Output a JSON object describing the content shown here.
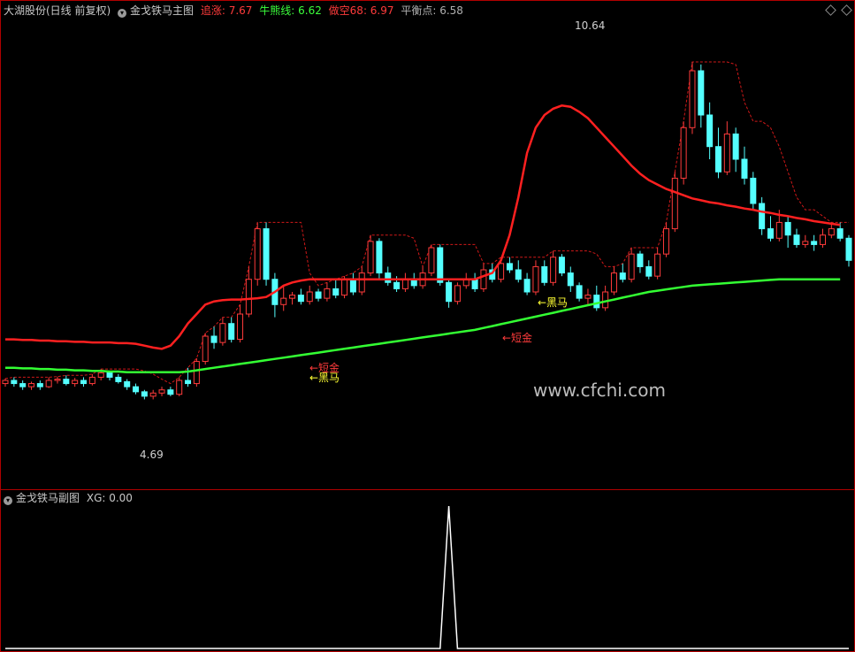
{
  "main_header": {
    "stock": "大湖股份(日线 前复权)",
    "indicator": "金戈铁马主图",
    "items": [
      {
        "label": "追涨: 7.67",
        "color": "#ff3b3b"
      },
      {
        "label": "牛熊线: 6.62",
        "color": "#3cff3c"
      },
      {
        "label": "做空68: 6.97",
        "color": "#ff3b3b"
      },
      {
        "label": "平衡点: 6.58",
        "color": "#b0b0b0"
      }
    ]
  },
  "sub_header": {
    "indicator": "金戈铁马副图",
    "xg": "XG: 0.00"
  },
  "icons": [
    "chevron-down-icon",
    "diamond-icon"
  ],
  "colors": {
    "up": "#ff3b3b",
    "down": "#54ffff",
    "bull_bear": "#33ff33",
    "chase": "#ff2020",
    "sub_line": "#ffffff",
    "frame": "#b00000"
  },
  "annotations": {
    "high_price": "10.64",
    "low_price": "4.69",
    "dark_horse_1": "←黑马",
    "short_gold_1": "←短金",
    "dark_horse_2": "←黑马",
    "short_gold_2": "←短金"
  },
  "watermark": "www.cfchi.com",
  "chart_data": [
    {
      "type": "candlestick",
      "title": "金戈铁马主图",
      "ylim": [
        4.2,
        11.2
      ],
      "series": [
        {
          "name": "追涨",
          "values": [
            6.25,
            6.25,
            6.24,
            6.24,
            6.23,
            6.23,
            6.22,
            6.22,
            6.21,
            6.21,
            6.2,
            6.2,
            6.2,
            6.19,
            6.19,
            6.18,
            6.15,
            6.12,
            6.1,
            6.15,
            6.3,
            6.5,
            6.65,
            6.8,
            6.85,
            6.87,
            6.88,
            6.88,
            6.89,
            6.9,
            6.92,
            7.0,
            7.1,
            7.15,
            7.18,
            7.2,
            7.2,
            7.2,
            7.2,
            7.2,
            7.2,
            7.2,
            7.2,
            7.2,
            7.2,
            7.2,
            7.2,
            7.2,
            7.2,
            7.2,
            7.2,
            7.2,
            7.2,
            7.2,
            7.2,
            7.25,
            7.3,
            7.5,
            7.9,
            8.5,
            9.2,
            9.6,
            9.8,
            9.9,
            9.95,
            9.93,
            9.85,
            9.75,
            9.6,
            9.45,
            9.3,
            9.15,
            9.0,
            8.87,
            8.77,
            8.7,
            8.63,
            8.58,
            8.53,
            8.48,
            8.45,
            8.42,
            8.4,
            8.37,
            8.35,
            8.32,
            8.3,
            8.27,
            8.25,
            8.22,
            8.2,
            8.17,
            8.15,
            8.12,
            8.1,
            8.08,
            8.06
          ]
        },
        {
          "name": "牛熊线",
          "values": [
            5.8,
            5.8,
            5.79,
            5.79,
            5.78,
            5.78,
            5.77,
            5.77,
            5.76,
            5.76,
            5.75,
            5.75,
            5.74,
            5.74,
            5.73,
            5.73,
            5.73,
            5.73,
            5.73,
            5.73,
            5.73,
            5.74,
            5.76,
            5.78,
            5.8,
            5.82,
            5.84,
            5.86,
            5.88,
            5.9,
            5.92,
            5.94,
            5.96,
            5.98,
            6.0,
            6.02,
            6.04,
            6.06,
            6.08,
            6.1,
            6.12,
            6.14,
            6.16,
            6.18,
            6.2,
            6.22,
            6.24,
            6.26,
            6.28,
            6.3,
            6.32,
            6.34,
            6.36,
            6.38,
            6.4,
            6.43,
            6.46,
            6.49,
            6.52,
            6.55,
            6.58,
            6.61,
            6.64,
            6.67,
            6.7,
            6.73,
            6.76,
            6.79,
            6.82,
            6.85,
            6.88,
            6.91,
            6.94,
            6.97,
            7.0,
            7.02,
            7.04,
            7.06,
            7.08,
            7.1,
            7.11,
            7.12,
            7.13,
            7.14,
            7.15,
            7.16,
            7.17,
            7.18,
            7.19,
            7.2,
            7.2,
            7.2,
            7.2,
            7.2,
            7.2,
            7.2,
            7.2
          ]
        }
      ],
      "candles": [
        [
          5.55,
          5.6,
          5.63,
          5.5
        ],
        [
          5.6,
          5.55,
          5.65,
          5.5
        ],
        [
          5.55,
          5.5,
          5.6,
          5.45
        ],
        [
          5.5,
          5.55,
          5.58,
          5.45
        ],
        [
          5.55,
          5.5,
          5.6,
          5.45
        ],
        [
          5.5,
          5.6,
          5.65,
          5.48
        ],
        [
          5.6,
          5.62,
          5.66,
          5.55
        ],
        [
          5.62,
          5.55,
          5.68,
          5.52
        ],
        [
          5.55,
          5.6,
          5.64,
          5.5
        ],
        [
          5.6,
          5.55,
          5.65,
          5.5
        ],
        [
          5.55,
          5.65,
          5.7,
          5.52
        ],
        [
          5.65,
          5.72,
          5.78,
          5.6
        ],
        [
          5.72,
          5.65,
          5.75,
          5.6
        ],
        [
          5.65,
          5.58,
          5.7,
          5.55
        ],
        [
          5.58,
          5.5,
          5.62,
          5.45
        ],
        [
          5.5,
          5.42,
          5.55,
          5.38
        ],
        [
          5.42,
          5.35,
          5.45,
          5.3
        ],
        [
          5.35,
          5.4,
          5.45,
          5.3
        ],
        [
          5.4,
          5.45,
          5.5,
          5.35
        ],
        [
          5.45,
          5.38,
          5.5,
          5.35
        ],
        [
          5.38,
          5.6,
          5.65,
          5.35
        ],
        [
          5.6,
          5.55,
          5.8,
          5.5
        ],
        [
          5.55,
          5.9,
          5.95,
          5.5
        ],
        [
          5.9,
          6.3,
          6.35,
          5.85
        ],
        [
          6.3,
          6.2,
          6.45,
          6.1
        ],
        [
          6.2,
          6.5,
          6.6,
          6.15
        ],
        [
          6.5,
          6.25,
          6.6,
          6.2
        ],
        [
          6.25,
          6.65,
          6.8,
          6.2
        ],
        [
          6.65,
          7.2,
          7.4,
          6.6
        ],
        [
          7.2,
          8.0,
          8.1,
          7.1
        ],
        [
          8.0,
          7.2,
          8.1,
          7.1
        ],
        [
          7.2,
          6.8,
          7.3,
          6.6
        ],
        [
          6.8,
          6.9,
          7.1,
          6.7
        ],
        [
          6.9,
          6.95,
          7.0,
          6.8
        ],
        [
          6.95,
          6.85,
          7.05,
          6.8
        ],
        [
          6.85,
          7.0,
          7.1,
          6.8
        ],
        [
          7.0,
          6.9,
          7.05,
          6.85
        ],
        [
          6.9,
          7.05,
          7.15,
          6.85
        ],
        [
          7.05,
          6.95,
          7.2,
          6.9
        ],
        [
          6.95,
          7.2,
          7.25,
          6.9
        ],
        [
          7.2,
          7.0,
          7.3,
          6.95
        ],
        [
          7.0,
          7.3,
          7.4,
          6.95
        ],
        [
          7.3,
          7.8,
          7.9,
          7.25
        ],
        [
          7.8,
          7.3,
          7.85,
          7.2
        ],
        [
          7.3,
          7.15,
          7.4,
          7.1
        ],
        [
          7.15,
          7.05,
          7.25,
          7.0
        ],
        [
          7.05,
          7.2,
          7.3,
          7.0
        ],
        [
          7.2,
          7.1,
          7.3,
          7.05
        ],
        [
          7.1,
          7.3,
          7.4,
          7.05
        ],
        [
          7.3,
          7.7,
          7.75,
          7.25
        ],
        [
          7.7,
          7.15,
          7.75,
          7.1
        ],
        [
          7.15,
          6.85,
          7.2,
          6.75
        ],
        [
          6.85,
          7.1,
          7.15,
          6.8
        ],
        [
          7.1,
          7.2,
          7.3,
          7.05
        ],
        [
          7.2,
          7.05,
          7.3,
          7.0
        ],
        [
          7.05,
          7.35,
          7.45,
          7.0
        ],
        [
          7.35,
          7.2,
          7.45,
          7.15
        ],
        [
          7.2,
          7.45,
          7.55,
          7.15
        ],
        [
          7.45,
          7.35,
          7.55,
          7.3
        ],
        [
          7.35,
          7.2,
          7.5,
          7.15
        ],
        [
          7.2,
          7.0,
          7.3,
          6.95
        ],
        [
          7.0,
          7.4,
          7.5,
          6.95
        ],
        [
          7.4,
          7.15,
          7.5,
          7.1
        ],
        [
          7.15,
          7.55,
          7.65,
          7.1
        ],
        [
          7.55,
          7.3,
          7.6,
          7.25
        ],
        [
          7.3,
          7.1,
          7.4,
          7.0
        ],
        [
          7.1,
          6.9,
          7.15,
          6.85
        ],
        [
          6.9,
          6.95,
          7.05,
          6.8
        ],
        [
          6.95,
          6.75,
          7.1,
          6.7
        ],
        [
          6.75,
          7.0,
          7.1,
          6.7
        ],
        [
          7.0,
          7.3,
          7.4,
          6.95
        ],
        [
          7.3,
          7.2,
          7.45,
          7.15
        ],
        [
          7.2,
          7.6,
          7.7,
          7.15
        ],
        [
          7.6,
          7.4,
          7.65,
          7.3
        ],
        [
          7.4,
          7.25,
          7.5,
          7.2
        ],
        [
          7.25,
          7.6,
          7.7,
          7.2
        ],
        [
          7.6,
          8.0,
          8.1,
          7.55
        ],
        [
          8.0,
          8.8,
          8.9,
          7.95
        ],
        [
          8.8,
          9.6,
          9.7,
          8.7
        ],
        [
          9.6,
          10.5,
          10.64,
          9.5
        ],
        [
          10.5,
          9.8,
          10.6,
          9.6
        ],
        [
          9.8,
          9.3,
          10.0,
          9.1
        ],
        [
          9.3,
          8.9,
          9.6,
          8.8
        ],
        [
          8.9,
          9.5,
          9.7,
          8.85
        ],
        [
          9.5,
          9.1,
          9.6,
          8.9
        ],
        [
          9.1,
          8.8,
          9.3,
          8.7
        ],
        [
          8.8,
          8.4,
          8.9,
          8.3
        ],
        [
          8.4,
          8.0,
          8.5,
          7.9
        ],
        [
          8.0,
          7.85,
          8.2,
          7.8
        ],
        [
          7.85,
          8.1,
          8.3,
          7.8
        ],
        [
          8.1,
          7.9,
          8.2,
          7.7
        ],
        [
          7.9,
          7.75,
          8.0,
          7.7
        ],
        [
          7.75,
          7.8,
          7.9,
          7.7
        ],
        [
          7.8,
          7.75,
          7.9,
          7.65
        ],
        [
          7.75,
          7.9,
          8.0,
          7.7
        ],
        [
          7.9,
          8.0,
          8.1,
          7.85
        ],
        [
          8.0,
          7.85,
          8.1,
          7.8
        ],
        [
          7.85,
          7.5,
          7.9,
          7.4
        ]
      ]
    },
    {
      "type": "line",
      "title": "金戈铁马副图",
      "series": [
        {
          "name": "XG",
          "values": [
            0,
            0,
            0,
            0,
            0,
            0,
            0,
            0,
            0,
            0,
            0,
            0,
            0,
            0,
            0,
            0,
            0,
            0,
            0,
            0,
            0,
            0,
            0,
            0,
            0,
            0,
            0,
            0,
            0,
            0,
            0,
            0,
            0,
            0,
            0,
            0,
            0,
            0,
            0,
            0,
            0,
            0,
            0,
            0,
            0,
            0,
            0,
            0,
            0,
            0,
            0,
            1,
            0,
            0,
            0,
            0,
            0,
            0,
            0,
            0,
            0,
            0,
            0,
            0,
            0,
            0,
            0,
            0,
            0,
            0,
            0,
            0,
            0,
            0,
            0,
            0,
            0,
            0,
            0,
            0,
            0,
            0,
            0,
            0,
            0,
            0,
            0,
            0,
            0,
            0,
            0,
            0,
            0,
            0,
            0,
            0,
            0,
            0
          ]
        }
      ]
    }
  ]
}
